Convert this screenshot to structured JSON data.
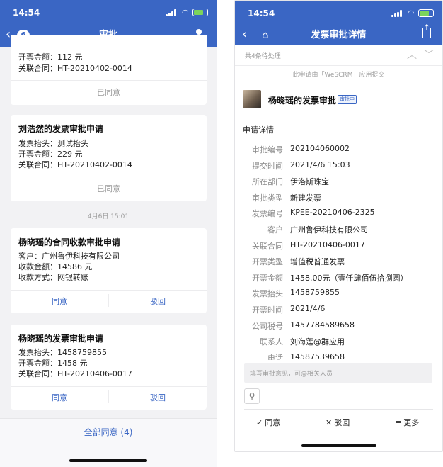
{
  "left": {
    "status": {
      "time": "14:54"
    },
    "nav": {
      "back_count": "6",
      "title": "审批"
    },
    "card1": {
      "fields": [
        {
          "label": "开票金额：",
          "value": "112 元"
        },
        {
          "label": "关联合同：",
          "value": "HT-20210402-0014"
        }
      ],
      "status_label": "已同意"
    },
    "card2": {
      "title": "刘浩然的发票审批申请",
      "fields": [
        {
          "label": "发票抬头：",
          "value": "测试抬头"
        },
        {
          "label": "开票金额：",
          "value": "229 元"
        },
        {
          "label": "关联合同：",
          "value": "HT-20210402-0014"
        }
      ],
      "status_label": "已同意"
    },
    "date_separator": "4月6日 15:01",
    "card3": {
      "title": "杨晓瑶的合同收款审批申请",
      "fields": [
        {
          "label": "客户：",
          "value": "广州鲁伊科技有限公司"
        },
        {
          "label": "收款金额：",
          "value": "14586 元"
        },
        {
          "label": "收款方式：",
          "value": "网银转账"
        }
      ],
      "approve_label": "同意",
      "reject_label": "驳回"
    },
    "card4": {
      "title": "杨晓瑶的发票审批申请",
      "fields": [
        {
          "label": "发票抬头：",
          "value": "1458759855"
        },
        {
          "label": "开票金额：",
          "value": "1458 元"
        },
        {
          "label": "关联合同：",
          "value": "HT-20210406-0017"
        }
      ],
      "approve_label": "同意",
      "reject_label": "驳回"
    },
    "approve_all_label": "全部同意 (4)"
  },
  "right": {
    "status": {
      "time": "14:54"
    },
    "nav": {
      "title": "发票审批详情"
    },
    "pending_text": "共4条待处理",
    "submit_note": "此申请由「WeSCRM」应用提交",
    "applicant_title": "杨晓瑶的发票审批",
    "status_tag": "审批中",
    "detail_heading": "申请详情",
    "details": [
      {
        "label": "审批编号",
        "value": "202104060002"
      },
      {
        "label": "提交时间",
        "value": "2021/4/6 15:03"
      },
      {
        "label": "所在部门",
        "value": "伊洛斯珠宝"
      },
      {
        "label": "审批类型",
        "value": "新建发票"
      },
      {
        "label": "发票编号",
        "value": "KPEE-20210406-2325"
      },
      {
        "label": "客户",
        "value": "广州鲁伊科技有限公司"
      },
      {
        "label": "关联合同",
        "value": "HT-20210406-0017"
      },
      {
        "label": "开票类型",
        "value": "增值税普通发票"
      },
      {
        "label": "开票金额",
        "value": "1458.00元（壹仟肆佰伍拾捌圆）"
      },
      {
        "label": "发票抬头",
        "value": "1458759855"
      },
      {
        "label": "开票时间",
        "value": "2021/4/6"
      },
      {
        "label": "公司税号",
        "value": "1457784589658"
      },
      {
        "label": "联系人",
        "value": "刘海莲@群应用"
      },
      {
        "label": "电话",
        "value": "14587539658"
      }
    ],
    "comment_placeholder": "填写审批意见，可@相关人员",
    "actions": {
      "approve": "同意",
      "reject": "驳回",
      "more": "更多"
    }
  },
  "colors": {
    "accent": "#3a66c4",
    "background": "#f2f2f4"
  },
  "icons": [
    "back-icon",
    "person-icon",
    "home-icon",
    "share-icon",
    "chevron-up-icon",
    "chevron-down-icon",
    "paperclip-icon",
    "check-icon",
    "close-icon",
    "menu-icon"
  ]
}
